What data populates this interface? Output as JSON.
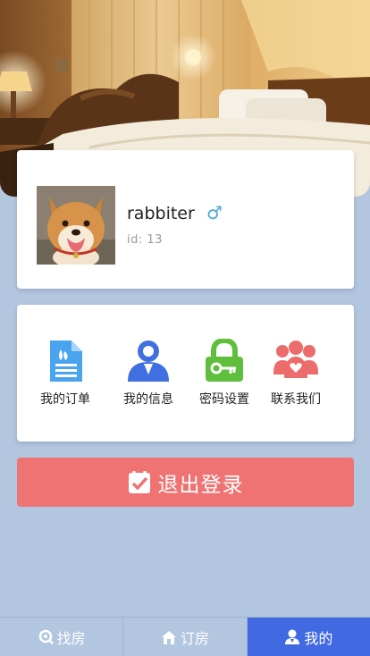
{
  "profile": {
    "username": "rabbiter",
    "gender_symbol": "♂",
    "id_text": "id:  13"
  },
  "menu": [
    {
      "label": "我的订单",
      "icon": "document-icon"
    },
    {
      "label": "我的信息",
      "icon": "user-icon"
    },
    {
      "label": "密码设置",
      "icon": "lock-icon"
    },
    {
      "label": "联系我们",
      "icon": "group-icon"
    }
  ],
  "logout": {
    "label": "退出登录",
    "icon": "check-icon"
  },
  "tabs": [
    {
      "label": "找房",
      "icon": "search-icon",
      "active": false
    },
    {
      "label": "订房",
      "icon": "home-icon",
      "active": false
    },
    {
      "label": "我的",
      "icon": "user-icon",
      "active": true
    }
  ],
  "colors": {
    "background": "#b3c6e0",
    "tab_active": "#4169e1",
    "logout": "#f07373",
    "gender": "#4da6d6"
  }
}
